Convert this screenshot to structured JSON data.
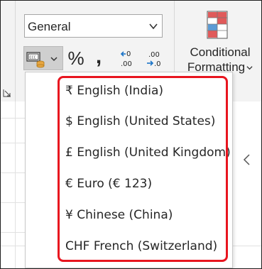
{
  "ribbon": {
    "number_format": {
      "value": "General"
    },
    "conditional_formatting": {
      "label_line1": "Conditional",
      "label_line2": "Formatting"
    },
    "percent_symbol": "%",
    "comma_symbol": ","
  },
  "currency_menu": {
    "items": [
      {
        "label": "₹ English (India)"
      },
      {
        "label": "$ English (United States)"
      },
      {
        "label": "£ English (United Kingdom)"
      },
      {
        "label": "€ Euro (€ 123)"
      },
      {
        "label": "¥ Chinese (China)"
      },
      {
        "label": "CHF French (Switzerland)"
      }
    ]
  },
  "colors": {
    "highlight": "#e8151f",
    "ribbon_bg": "#f3f3f3"
  }
}
